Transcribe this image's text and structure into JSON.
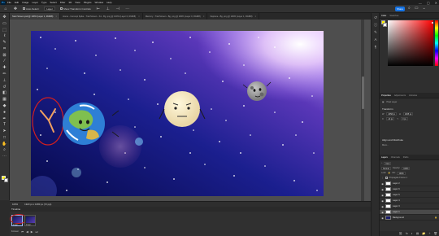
{
  "menubar": {
    "logo": "Ps",
    "items": [
      "File",
      "Edit",
      "Image",
      "Layer",
      "Type",
      "Select",
      "Filter",
      "3D",
      "View",
      "Plugins",
      "Window",
      "Help"
    ],
    "controls": [
      "—",
      "▢",
      "✕"
    ]
  },
  "options": {
    "auto_select_label": "Auto-Select:",
    "auto_select_value": "Layer",
    "show_transform_label": "Show Transform Controls",
    "share_label": "Share"
  },
  "tabs": [
    {
      "label": "Start Screen.psd @ 100% (Layer 1, RGB/8)",
      "active": true
    },
    {
      "label": "Home - Concept Spike - Trial Screen - S1 - Bg .png @ 100% (Layer 0, RGB/8)",
      "active": false
    },
    {
      "label": "Mercury - Trial Screen - Bg .png @ 100% (Layer 0, RGB/8)",
      "active": false
    },
    {
      "label": "Neptune - Bg .png @ 100% (Layer 1, RGB/8)",
      "active": false
    }
  ],
  "status": {
    "zoom": "100%",
    "doc_info": "1920 px x 1080 px (72 ppi)"
  },
  "timeline": {
    "tab_label": "Timeline",
    "frames": [
      {
        "number": "1",
        "delay": "0 sec."
      },
      {
        "number": "2",
        "delay": "0 sec."
      }
    ],
    "loop_value": "Forever",
    "controls": [
      "⏮",
      "◀",
      "▶",
      "⏭"
    ]
  },
  "panels": {
    "color_tabs": [
      "Color",
      "Swatches"
    ],
    "properties_tabs": [
      "Properties",
      "Adjustments",
      "Libraries"
    ],
    "pixel_layer_label": "Pixel Layer",
    "transform_title": "Transform",
    "transform": {
      "w": "2058 px",
      "h": "1065 px",
      "x": "-13 px",
      "y": "0 px"
    },
    "align_title": "Align and Distribute",
    "more_label": "More...",
    "layers_tabs": [
      "Layers",
      "Channels",
      "Paths"
    ],
    "kind_label": "Kind",
    "blend_mode": "Normal",
    "opacity_label": "Opacity:",
    "opacity_value": "100%",
    "lock_label": "Lock:",
    "fill_label": "Fill:",
    "fill_value": "100%",
    "propagate_label": "Propagate Frame 1",
    "layers": [
      {
        "name": "Layer 2",
        "active": false
      },
      {
        "name": "Layer 6",
        "active": false
      },
      {
        "name": "Layer 5",
        "active": false
      },
      {
        "name": "Layer 4",
        "active": false
      },
      {
        "name": "Layer 3",
        "active": false
      },
      {
        "name": "Layer 1",
        "active": true
      },
      {
        "name": "Background",
        "active": false,
        "bg": true
      }
    ],
    "footer_icons": [
      "⛓",
      "fx",
      "◐",
      "▤",
      "📁",
      "+",
      "🗑"
    ]
  },
  "colors": {
    "foreground": "#fff200",
    "background": "#ffffff",
    "accent": "#1473e6",
    "annotation": "#d11f1f"
  }
}
